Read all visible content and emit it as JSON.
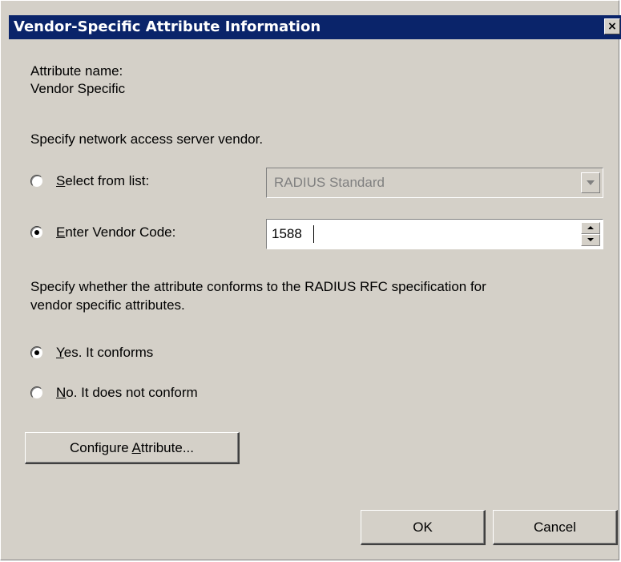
{
  "window": {
    "title": "Vendor-Specific Attribute Information",
    "close_glyph": "×"
  },
  "attribute": {
    "name_label": "Attribute name:",
    "name_value": "Vendor Specific"
  },
  "vendor": {
    "prompt": "Specify network access server vendor.",
    "select_from_list": {
      "mnemonic": "S",
      "rest": "elect from list:",
      "selected": false,
      "combo_value": "RADIUS Standard",
      "combo_enabled": false
    },
    "enter_vendor_code": {
      "mnemonic": "E",
      "rest": "nter Vendor Code:",
      "selected": true,
      "value": "1588"
    }
  },
  "conformance": {
    "prompt_line1": "Specify whether the attribute conforms to the RADIUS RFC specification for",
    "prompt_line2": "vendor specific attributes.",
    "yes": {
      "mnemonic": "Y",
      "rest": "es. It conforms",
      "selected": true
    },
    "no": {
      "mnemonic": "N",
      "rest": "o. It does not conform",
      "selected": false
    }
  },
  "buttons": {
    "configure": {
      "before": "Configure ",
      "mnemonic": "A",
      "after": "ttribute..."
    },
    "ok": "OK",
    "cancel": "Cancel"
  },
  "colors": {
    "dialog_face": "#d4d0c8",
    "titlebar": "#0a246a",
    "disabled_text": "#808080"
  }
}
